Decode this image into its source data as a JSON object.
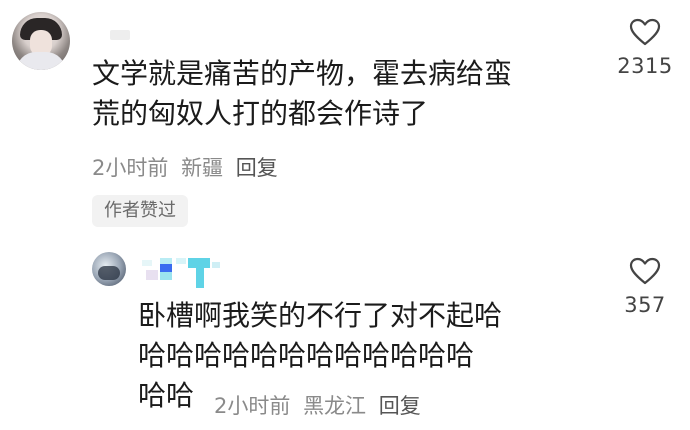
{
  "comments": [
    {
      "text_lines": [
        "文学就是痛苦的产物，霍去病给蛮",
        "荒的匈奴人打的都会作诗了"
      ],
      "time": "2小时前",
      "location": "新疆",
      "reply_label": "回复",
      "badge": "作者赞过",
      "likes": "2315"
    },
    {
      "text_lines": [
        "卧槽啊我笑的不行了对不起哈",
        "哈哈哈哈哈哈哈哈哈哈哈哈",
        "哈哈"
      ],
      "time": "2小时前",
      "location": "黑龙江",
      "reply_label": "回复",
      "likes": "357"
    }
  ],
  "icons": {
    "like": "heart-outline-icon"
  },
  "colors": {
    "text": "#1b1b1b",
    "meta": "#8a8a8a",
    "badge_bg": "#f2f2f2",
    "mosaic_cyan": "#5fd3e6",
    "mosaic_blue": "#3b6cf0"
  }
}
